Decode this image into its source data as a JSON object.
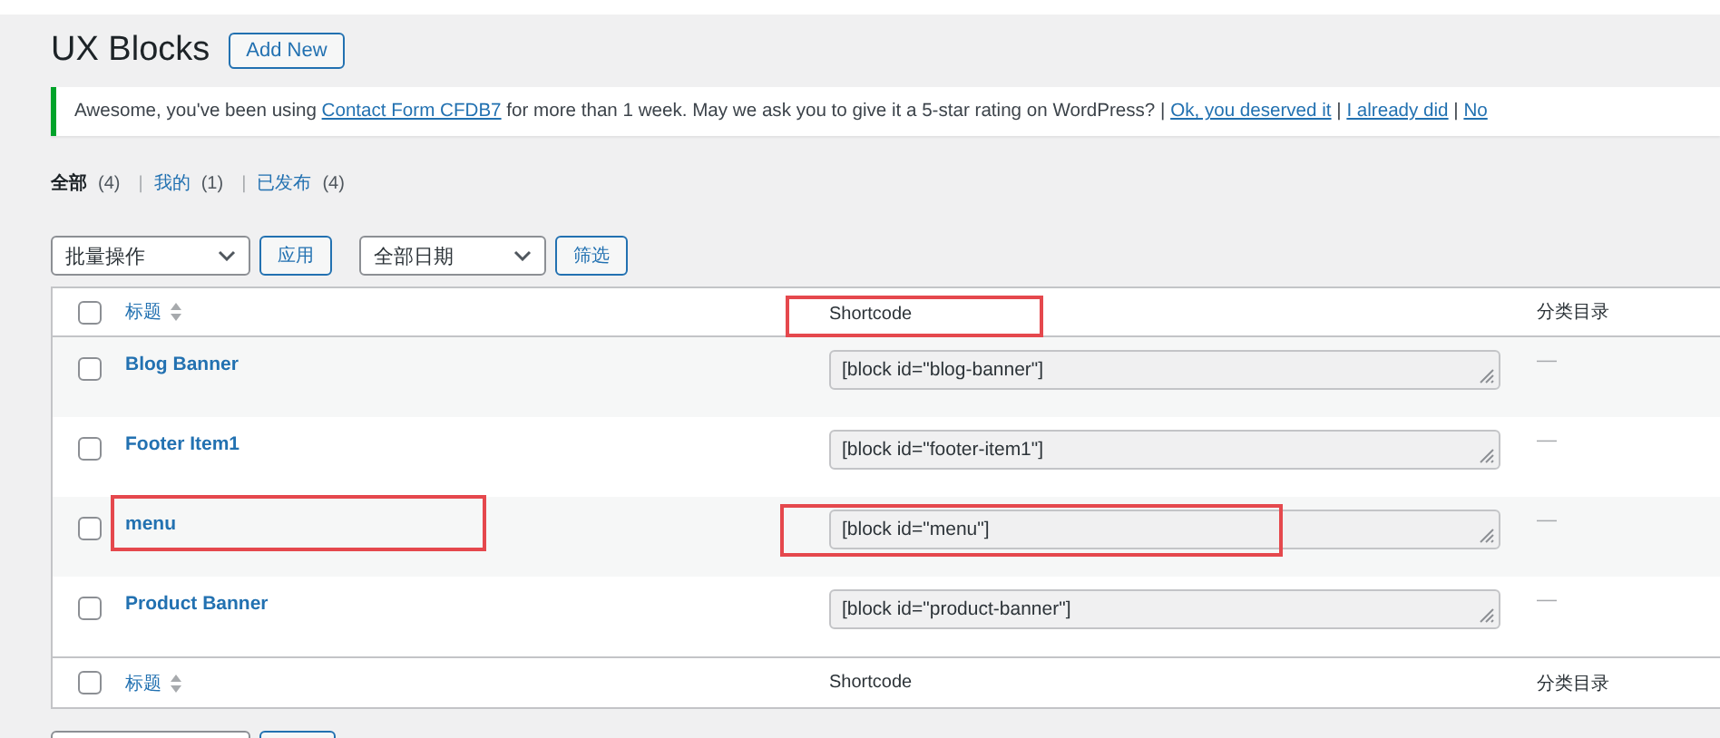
{
  "page_title": "UX Blocks",
  "add_new_button": "Add New",
  "notice": {
    "parts": [
      {
        "kind": "text",
        "text": "Awesome, you've been using "
      },
      {
        "kind": "link",
        "text": "Contact Form CFDB7"
      },
      {
        "kind": "text",
        "text": " for more than 1 week. May we ask you to give it a 5-star rating on WordPress? | "
      },
      {
        "kind": "link",
        "text": "Ok, you deserved it"
      },
      {
        "kind": "text",
        "text": " | "
      },
      {
        "kind": "link",
        "text": "I already did"
      },
      {
        "kind": "text",
        "text": " | "
      },
      {
        "kind": "link",
        "text": "No"
      }
    ]
  },
  "views": [
    {
      "label": "全部",
      "count": "(4)",
      "selected": true
    },
    {
      "separator": "|",
      "label": "我的",
      "count": "(1)",
      "selected": false
    },
    {
      "separator": "|",
      "label": "已发布",
      "count": "(4)",
      "selected": false
    }
  ],
  "toolbar": {
    "bulk_action": "批量操作",
    "apply_button": "应用",
    "date_filter": "全部日期",
    "filter_button": "筛选"
  },
  "table": {
    "select_all_checked": false,
    "columns": [
      {
        "label": "标题",
        "sortable": true,
        "highlighted": false
      },
      {
        "label": "Shortcode",
        "sortable": false,
        "highlighted": true
      },
      {
        "label": "分类目录",
        "sortable": false,
        "highlighted": false
      }
    ],
    "rows": [
      {
        "title": "Blog Banner",
        "shortcode": "[block id=\"blog-banner\"]",
        "category": "—",
        "checked": false,
        "title_highlighted": false,
        "shortcode_highlighted": false
      },
      {
        "title": "Footer Item1",
        "shortcode": "[block id=\"footer-item1\"]",
        "category": "—",
        "checked": false,
        "title_highlighted": false,
        "shortcode_highlighted": false
      },
      {
        "title": "menu",
        "shortcode": "[block id=\"menu\"]",
        "category": "—",
        "checked": false,
        "title_highlighted": true,
        "shortcode_highlighted": true
      },
      {
        "title": "Product Banner",
        "shortcode": "[block id=\"product-banner\"]",
        "category": "—",
        "checked": false,
        "title_highlighted": false,
        "shortcode_highlighted": false
      }
    ],
    "footer_columns": [
      {
        "label": "标题",
        "sortable": true
      },
      {
        "label": "Shortcode",
        "sortable": false
      },
      {
        "label": "分类目录",
        "sortable": false
      }
    ]
  }
}
